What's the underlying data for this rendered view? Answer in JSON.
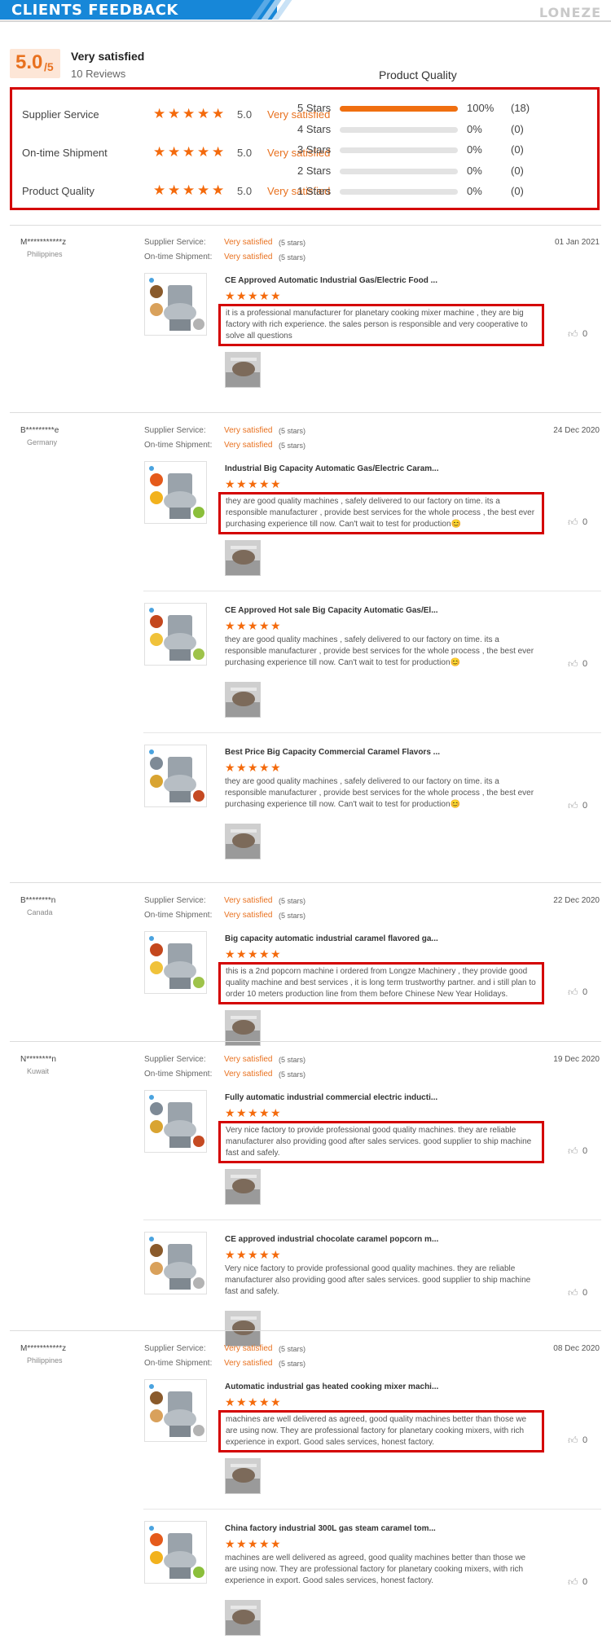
{
  "header": {
    "title": "CLIENTS FEEDBACK",
    "brand": "LONEZE"
  },
  "summary": {
    "score": "5.0",
    "score_suffix": "/5",
    "verdict": "Very satisfied",
    "review_count": "10 Reviews",
    "distribution_heading": "Product Quality",
    "categories": [
      {
        "label": "Supplier Service",
        "stars": 5,
        "score": "5.0",
        "verdict": "Very satisfied"
      },
      {
        "label": "On-time Shipment",
        "stars": 5,
        "score": "5.0",
        "verdict": "Very satisfied"
      },
      {
        "label": "Product Quality",
        "stars": 5,
        "score": "5.0",
        "verdict": "Very satisfied"
      }
    ],
    "distribution": [
      {
        "label": "5 Stars",
        "percent": "100%",
        "count": "(18)",
        "fill": 1.0
      },
      {
        "label": "4 Stars",
        "percent": "0%",
        "count": "(0)",
        "fill": 0
      },
      {
        "label": "3 Stars",
        "percent": "0%",
        "count": "(0)",
        "fill": 0
      },
      {
        "label": "2 Stars",
        "percent": "0%",
        "count": "(0)",
        "fill": 0
      },
      {
        "label": "1 Stars",
        "percent": "0%",
        "count": "(0)",
        "fill": 0
      }
    ]
  },
  "rating_labels": {
    "supplier_service": "Supplier Service:",
    "on_time_shipment": "On-time Shipment:",
    "value": "Very satisfied",
    "stars_note": "(5 stars)"
  },
  "reviews": [
    {
      "user": "M***********z",
      "country": "Philippines",
      "date": "01 Jan 2021",
      "items": [
        {
          "title": "CE Approved Automatic Industrial Gas/Electric Food ...",
          "stars": 5,
          "comment": "it is a professional manufacturer for planetary cooking mixer machine , they are big factory with rich experience. the sales person is responsible and very cooperative to solve all questions",
          "likes": "0"
        }
      ]
    },
    {
      "user": "B*********e",
      "country": "Germany",
      "date": "24 Dec 2020",
      "items": [
        {
          "title": "Industrial Big Capacity Automatic Gas/Electric Caram...",
          "stars": 5,
          "comment": "they are good quality machines , safely delivered to our factory on time. its a responsible manufacturer , provide best services for the whole process , the best ever purchasing experience till now. Can't wait to test for production😊",
          "likes": "0"
        },
        {
          "title": "CE Approved Hot sale Big Capacity Automatic Gas/El...",
          "stars": 5,
          "comment": "they are good quality machines , safely delivered to our factory on time. its a responsible manufacturer , provide best services for the whole process , the best ever purchasing experience till now. Can't wait to test for production😊",
          "likes": "0"
        },
        {
          "title": "Best Price Big Capacity Commercial Caramel Flavors ...",
          "stars": 5,
          "comment": "they are good quality machines , safely delivered to our factory on time. its a responsible manufacturer , provide best services for the whole process , the best ever purchasing experience till now. Can't wait to test for production😊",
          "likes": "0"
        }
      ]
    },
    {
      "user": "B********n",
      "country": "Canada",
      "date": "22 Dec 2020",
      "items": [
        {
          "title": "Big capacity automatic industrial caramel flavored ga...",
          "stars": 5,
          "comment": "this is a 2nd popcorn machine i ordered from Longze Machinery , they provide good quality machine and best services , it is long term trustworthy partner. and i still plan to order 10 meters production line from them before Chinese New Year Holidays.",
          "likes": "0"
        }
      ]
    },
    {
      "user": "N********n",
      "country": "Kuwait",
      "date": "19 Dec 2020",
      "items": [
        {
          "title": "Fully automatic industrial commercial electric inducti...",
          "stars": 5,
          "comment": "Very nice factory to provide professional good quality machines. they are reliable manufacturer also providing good after sales services. good supplier to ship machine fast and safely.",
          "likes": "0"
        },
        {
          "title": "CE approved industrial chocolate caramel popcorn m...",
          "stars": 5,
          "comment": "Very nice factory to provide professional good quality machines. they are reliable manufacturer also providing good after sales services. good supplier to ship machine fast and safely.",
          "likes": "0"
        }
      ]
    },
    {
      "user": "M***********z",
      "country": "Philippines",
      "date": "08 Dec 2020",
      "items": [
        {
          "title": "Automatic industrial gas heated cooking mixer machi...",
          "stars": 5,
          "comment": "machines are well delivered as agreed, good quality machines better than those we are using now. They are professional factory for planetary cooking mixers, with rich experience in export. Good sales services, honest factory.",
          "likes": "0"
        },
        {
          "title": "China factory industrial 300L gas steam caramel tom...",
          "stars": 5,
          "comment": "machines are well delivered as agreed, good quality machines better than those we are using now. They are professional factory for planetary cooking mixers, with rich experience in export. Good sales services, honest factory.",
          "likes": "0"
        }
      ]
    }
  ]
}
